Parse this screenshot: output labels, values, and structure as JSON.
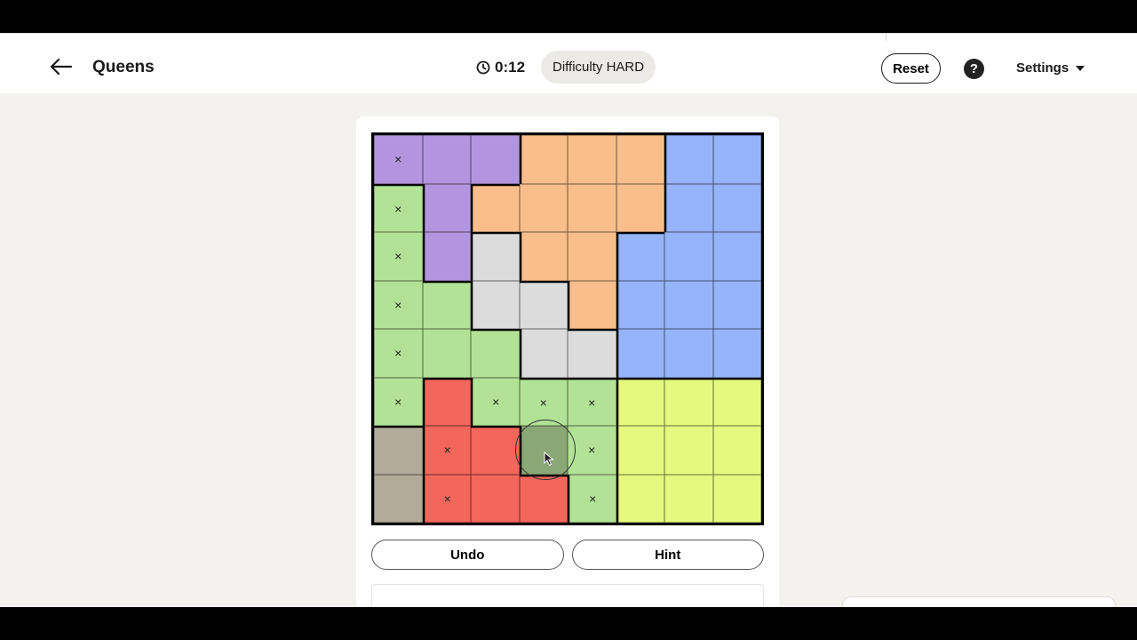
{
  "header": {
    "title": "Queens",
    "timer": "0:12",
    "difficulty": "Difficulty HARD",
    "reset_label": "Reset",
    "help_label": "?",
    "settings_label": "Settings"
  },
  "controls": {
    "undo_label": "Undo",
    "hint_label": "Hint"
  },
  "board": {
    "size": 8,
    "colors": {
      "purple": "#b394de",
      "orange": "#f9be8b",
      "blue": "#95b4fa",
      "green": "#b2e296",
      "gray": "#dcdcdc",
      "red": "#f2665b",
      "yellow": "#e4f97e",
      "taupe": "#b3ab9a"
    },
    "regions": [
      [
        "purple",
        "purple",
        "purple",
        "orange",
        "orange",
        "orange",
        "blue",
        "blue"
      ],
      [
        "green",
        "purple",
        "orange",
        "orange",
        "orange",
        "orange",
        "blue",
        "blue"
      ],
      [
        "green",
        "purple",
        "gray",
        "orange",
        "orange",
        "blue",
        "blue",
        "blue"
      ],
      [
        "green",
        "green",
        "gray",
        "gray",
        "orange",
        "blue",
        "blue",
        "blue"
      ],
      [
        "green",
        "green",
        "green",
        "gray",
        "gray",
        "blue",
        "blue",
        "blue"
      ],
      [
        "green",
        "red",
        "green",
        "green",
        "green",
        "yellow",
        "yellow",
        "yellow"
      ],
      [
        "taupe",
        "red",
        "red",
        "green",
        "green",
        "yellow",
        "yellow",
        "yellow"
      ],
      [
        "taupe",
        "red",
        "red",
        "red",
        "green",
        "yellow",
        "yellow",
        "yellow"
      ]
    ],
    "marks": [
      [
        "×",
        "",
        "",
        "",
        "",
        "",
        "",
        ""
      ],
      [
        "×",
        "",
        "",
        "",
        "",
        "",
        "",
        ""
      ],
      [
        "×",
        "",
        "",
        "",
        "",
        "",
        "",
        ""
      ],
      [
        "×",
        "",
        "",
        "",
        "",
        "",
        "",
        ""
      ],
      [
        "×",
        "",
        "",
        "",
        "",
        "",
        "",
        ""
      ],
      [
        "×",
        "",
        "×",
        "×",
        "×",
        "",
        "",
        ""
      ],
      [
        "",
        "×",
        "",
        "",
        "×",
        "",
        "",
        ""
      ],
      [
        "",
        "×",
        "",
        "",
        "×",
        "",
        "",
        ""
      ]
    ],
    "hover_cell": [
      6,
      3
    ]
  }
}
